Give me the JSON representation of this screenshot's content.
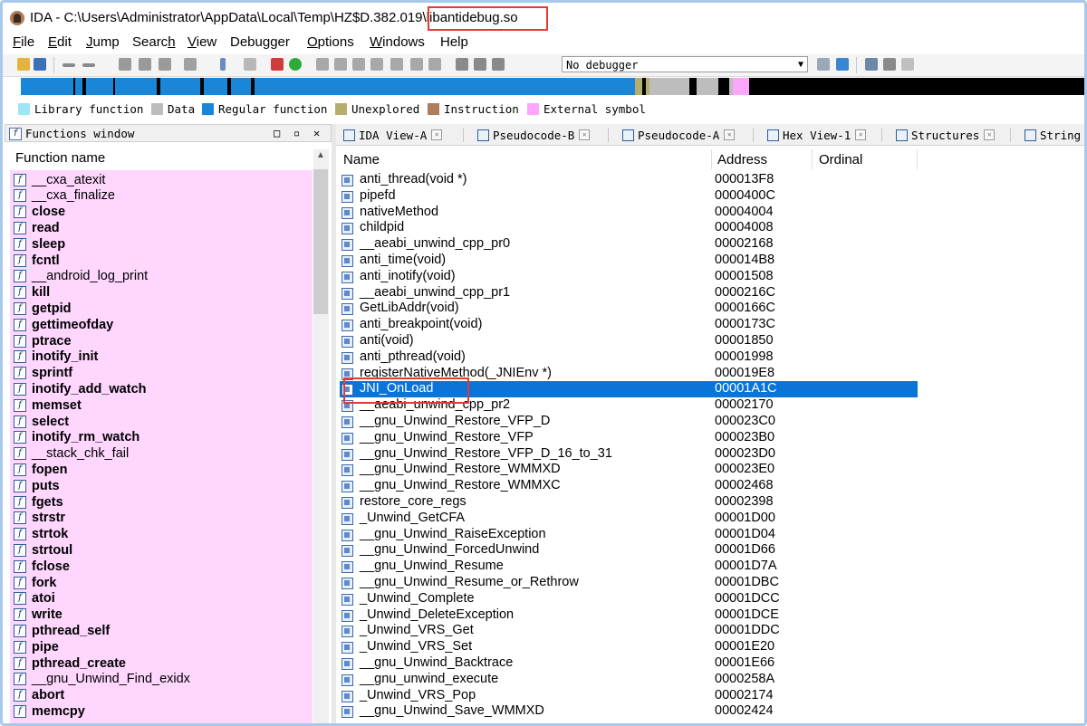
{
  "window": {
    "title_prefix": "IDA - C:\\Users\\Administrator\\AppData\\Local\\Temp\\HZ$D.382.019",
    "title_file": "\\libantidebug.so"
  },
  "menu": [
    {
      "pre": "",
      "u": "F",
      "post": "ile"
    },
    {
      "pre": "",
      "u": "E",
      "post": "dit"
    },
    {
      "pre": "",
      "u": "J",
      "post": "ump"
    },
    {
      "pre": "Searc",
      "u": "h",
      "post": ""
    },
    {
      "pre": "",
      "u": "V",
      "post": "iew"
    },
    {
      "pre": "Debugger",
      "u": "",
      "post": ""
    },
    {
      "pre": "",
      "u": "O",
      "post": "ptions"
    },
    {
      "pre": "",
      "u": "W",
      "post": "indows"
    },
    {
      "pre": "Help",
      "u": "",
      "post": ""
    }
  ],
  "toolbar": {
    "debugger_value": "No debugger"
  },
  "legend": [
    {
      "label": "Library function",
      "color": "#9de6f5"
    },
    {
      "label": "Data",
      "color": "#bdbdbd"
    },
    {
      "label": "Regular function",
      "color": "#1a86d8"
    },
    {
      "label": "Unexplored",
      "color": "#b5ad6c"
    },
    {
      "label": "Instruction",
      "color": "#b07c5c"
    },
    {
      "label": "External symbol",
      "color": "#fda6fb"
    }
  ],
  "functions_window": {
    "title": "Functions window",
    "column": "Function name",
    "items": [
      {
        "name": "__cxa_atexit",
        "bold": false
      },
      {
        "name": "__cxa_finalize",
        "bold": false
      },
      {
        "name": "close",
        "bold": true
      },
      {
        "name": "read",
        "bold": true
      },
      {
        "name": "sleep",
        "bold": true
      },
      {
        "name": "fcntl",
        "bold": true
      },
      {
        "name": "__android_log_print",
        "bold": false
      },
      {
        "name": "kill",
        "bold": true
      },
      {
        "name": "getpid",
        "bold": true
      },
      {
        "name": "gettimeofday",
        "bold": true
      },
      {
        "name": "ptrace",
        "bold": true
      },
      {
        "name": "inotify_init",
        "bold": true
      },
      {
        "name": "sprintf",
        "bold": true
      },
      {
        "name": "inotify_add_watch",
        "bold": true
      },
      {
        "name": "memset",
        "bold": true
      },
      {
        "name": "select",
        "bold": true
      },
      {
        "name": "inotify_rm_watch",
        "bold": true
      },
      {
        "name": "__stack_chk_fail",
        "bold": false
      },
      {
        "name": "fopen",
        "bold": true
      },
      {
        "name": "puts",
        "bold": true
      },
      {
        "name": "fgets",
        "bold": true
      },
      {
        "name": "strstr",
        "bold": true
      },
      {
        "name": "strtok",
        "bold": true
      },
      {
        "name": "strtoul",
        "bold": true
      },
      {
        "name": "fclose",
        "bold": true
      },
      {
        "name": "fork",
        "bold": true
      },
      {
        "name": "atoi",
        "bold": true
      },
      {
        "name": "write",
        "bold": true
      },
      {
        "name": "pthread_self",
        "bold": true
      },
      {
        "name": "pipe",
        "bold": true
      },
      {
        "name": "pthread_create",
        "bold": true
      },
      {
        "name": "__gnu_Unwind_Find_exidx",
        "bold": false
      },
      {
        "name": "abort",
        "bold": true
      },
      {
        "name": "memcpy",
        "bold": true
      }
    ]
  },
  "tabs": [
    {
      "label": "IDA View-A"
    },
    {
      "label": "Pseudocode-B"
    },
    {
      "label": "Pseudocode-A"
    },
    {
      "label": "Hex View-1"
    },
    {
      "label": "Structures"
    },
    {
      "label": "String"
    }
  ],
  "exports": {
    "columns": {
      "name": "Name",
      "address": "Address",
      "ordinal": "Ordinal"
    },
    "selected_index": 13,
    "rows": [
      {
        "name": "anti_thread(void *)",
        "address": "000013F8"
      },
      {
        "name": "pipefd",
        "address": "0000400C"
      },
      {
        "name": "nativeMethod",
        "address": "00004004"
      },
      {
        "name": "childpid",
        "address": "00004008"
      },
      {
        "name": "__aeabi_unwind_cpp_pr0",
        "address": "00002168"
      },
      {
        "name": "anti_time(void)",
        "address": "000014B8"
      },
      {
        "name": "anti_inotify(void)",
        "address": "00001508"
      },
      {
        "name": "__aeabi_unwind_cpp_pr1",
        "address": "0000216C"
      },
      {
        "name": "GetLibAddr(void)",
        "address": "0000166C"
      },
      {
        "name": "anti_breakpoint(void)",
        "address": "0000173C"
      },
      {
        "name": "anti(void)",
        "address": "00001850"
      },
      {
        "name": "anti_pthread(void)",
        "address": "00001998"
      },
      {
        "name": "registerNativeMethod(_JNIEnv *)",
        "address": "000019E8"
      },
      {
        "name": "JNI_OnLoad",
        "address": "00001A1C"
      },
      {
        "name": "__aeabi_unwind_cpp_pr2",
        "address": "00002170"
      },
      {
        "name": "__gnu_Unwind_Restore_VFP_D",
        "address": "000023C0"
      },
      {
        "name": "__gnu_Unwind_Restore_VFP",
        "address": "000023B0"
      },
      {
        "name": "__gnu_Unwind_Restore_VFP_D_16_to_31",
        "address": "000023D0"
      },
      {
        "name": "__gnu_Unwind_Restore_WMMXD",
        "address": "000023E0"
      },
      {
        "name": "__gnu_Unwind_Restore_WMMXC",
        "address": "00002468"
      },
      {
        "name": "restore_core_regs",
        "address": "00002398"
      },
      {
        "name": "_Unwind_GetCFA",
        "address": "00001D00"
      },
      {
        "name": "__gnu_Unwind_RaiseException",
        "address": "00001D04"
      },
      {
        "name": "__gnu_Unwind_ForcedUnwind",
        "address": "00001D66"
      },
      {
        "name": "__gnu_Unwind_Resume",
        "address": "00001D7A"
      },
      {
        "name": "__gnu_Unwind_Resume_or_Rethrow",
        "address": "00001DBC"
      },
      {
        "name": "_Unwind_Complete",
        "address": "00001DCC"
      },
      {
        "name": "_Unwind_DeleteException",
        "address": "00001DCE"
      },
      {
        "name": "_Unwind_VRS_Get",
        "address": "00001DDC"
      },
      {
        "name": "_Unwind_VRS_Set",
        "address": "00001E20"
      },
      {
        "name": "__gnu_Unwind_Backtrace",
        "address": "00001E66"
      },
      {
        "name": "__gnu_unwind_execute",
        "address": "0000258A"
      },
      {
        "name": "_Unwind_VRS_Pop",
        "address": "00002174"
      },
      {
        "name": "__gnu_Unwind_Save_WMMXD",
        "address": "00002424"
      }
    ]
  }
}
